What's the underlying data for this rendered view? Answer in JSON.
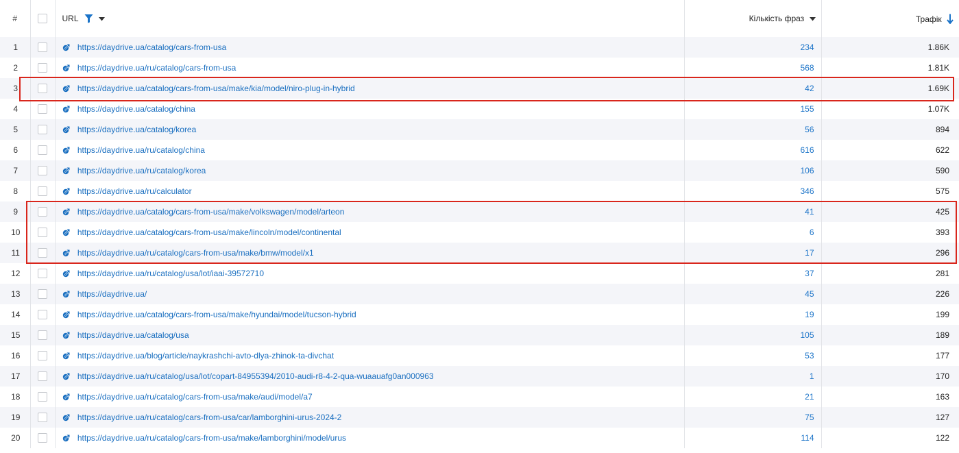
{
  "header": {
    "num": "#",
    "url": "URL",
    "phrases": "Кількість фраз",
    "traffic": "Трафік"
  },
  "colors": {
    "link": "#1a6fc0",
    "highlight": "#d9261c",
    "stripe": "#f4f5f9"
  },
  "rows": [
    {
      "num": "1",
      "url": "https://daydrive.ua/catalog/cars-from-usa",
      "phrases": "234",
      "traffic": "1.86K"
    },
    {
      "num": "2",
      "url": "https://daydrive.ua/ru/catalog/cars-from-usa",
      "phrases": "568",
      "traffic": "1.81K"
    },
    {
      "num": "3",
      "url": "https://daydrive.ua/catalog/cars-from-usa/make/kia/model/niro-plug-in-hybrid",
      "phrases": "42",
      "traffic": "1.69K"
    },
    {
      "num": "4",
      "url": "https://daydrive.ua/catalog/china",
      "phrases": "155",
      "traffic": "1.07K"
    },
    {
      "num": "5",
      "url": "https://daydrive.ua/catalog/korea",
      "phrases": "56",
      "traffic": "894"
    },
    {
      "num": "6",
      "url": "https://daydrive.ua/ru/catalog/china",
      "phrases": "616",
      "traffic": "622"
    },
    {
      "num": "7",
      "url": "https://daydrive.ua/ru/catalog/korea",
      "phrases": "106",
      "traffic": "590"
    },
    {
      "num": "8",
      "url": "https://daydrive.ua/ru/calculator",
      "phrases": "346",
      "traffic": "575"
    },
    {
      "num": "9",
      "url": "https://daydrive.ua/catalog/cars-from-usa/make/volkswagen/model/arteon",
      "phrases": "41",
      "traffic": "425"
    },
    {
      "num": "10",
      "url": "https://daydrive.ua/catalog/cars-from-usa/make/lincoln/model/continental",
      "phrases": "6",
      "traffic": "393"
    },
    {
      "num": "11",
      "url": "https://daydrive.ua/ru/catalog/cars-from-usa/make/bmw/model/x1",
      "phrases": "17",
      "traffic": "296"
    },
    {
      "num": "12",
      "url": "https://daydrive.ua/ru/catalog/usa/lot/iaai-39572710",
      "phrases": "37",
      "traffic": "281"
    },
    {
      "num": "13",
      "url": "https://daydrive.ua/",
      "phrases": "45",
      "traffic": "226"
    },
    {
      "num": "14",
      "url": "https://daydrive.ua/catalog/cars-from-usa/make/hyundai/model/tucson-hybrid",
      "phrases": "19",
      "traffic": "199"
    },
    {
      "num": "15",
      "url": "https://daydrive.ua/catalog/usa",
      "phrases": "105",
      "traffic": "189"
    },
    {
      "num": "16",
      "url": "https://daydrive.ua/blog/article/naykrashchi-avto-dlya-zhinok-ta-divchat",
      "phrases": "53",
      "traffic": "177"
    },
    {
      "num": "17",
      "url": "https://daydrive.ua/ru/catalog/usa/lot/copart-84955394/2010-audi-r8-4-2-qua-wuaauafg0an000963",
      "phrases": "1",
      "traffic": "170"
    },
    {
      "num": "18",
      "url": "https://daydrive.ua/ru/catalog/cars-from-usa/make/audi/model/a7",
      "phrases": "21",
      "traffic": "163"
    },
    {
      "num": "19",
      "url": "https://daydrive.ua/ru/catalog/cars-from-usa/car/lamborghini-urus-2024-2",
      "phrases": "75",
      "traffic": "127"
    },
    {
      "num": "20",
      "url": "https://daydrive.ua/ru/catalog/cars-from-usa/make/lamborghini/model/urus",
      "phrases": "114",
      "traffic": "122"
    }
  ]
}
